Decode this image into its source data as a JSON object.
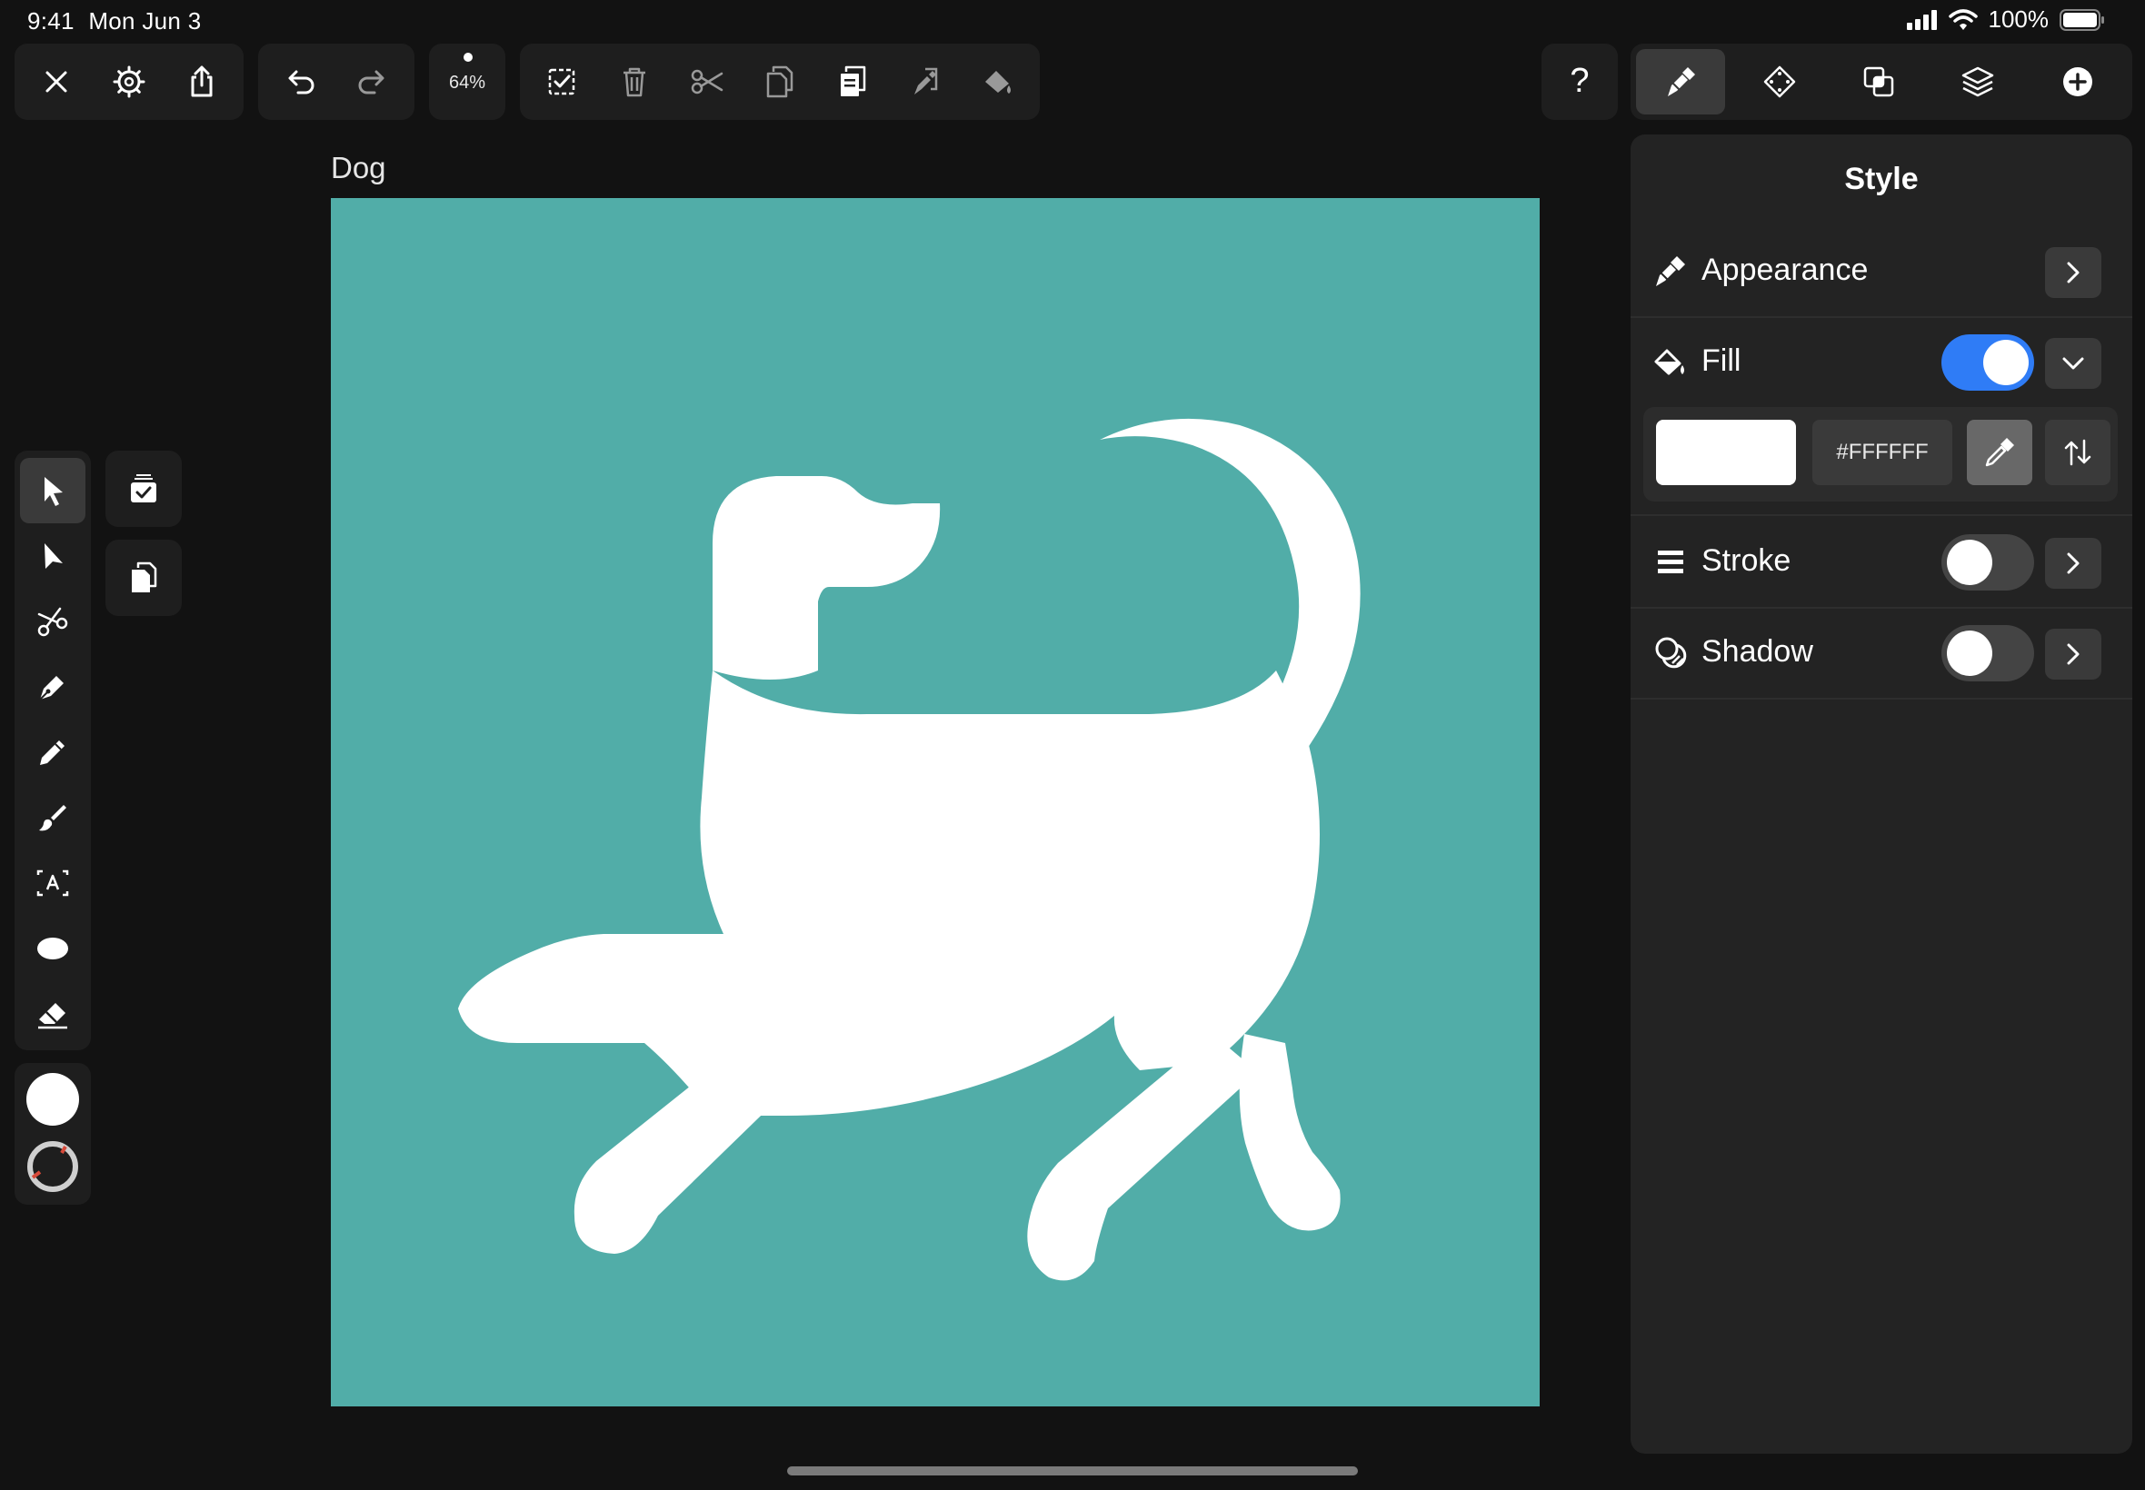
{
  "status_bar": {
    "time": "9:41",
    "date": "Mon Jun 3",
    "battery": "100%"
  },
  "toolbar": {
    "zoom": "64%",
    "left_group": [
      "close-icon",
      "settings-icon",
      "share-icon"
    ],
    "history_group": [
      "undo-icon",
      "redo-icon"
    ],
    "edit_group": [
      "select-all-icon",
      "trash-icon",
      "scissors-icon",
      "copy-icon",
      "paste-icon",
      "paste-style-icon",
      "fill-bucket-icon"
    ],
    "help_label": "?",
    "tabs": [
      "style-brush-icon",
      "shape-icon",
      "boolean-ops-icon",
      "layers-icon",
      "add-icon"
    ]
  },
  "document": {
    "title": "Dog",
    "canvas_color": "#51ada8",
    "artwork_color": "#ffffff"
  },
  "tools": [
    "selection-arrow-icon",
    "direct-selection-icon",
    "scissors-tool-icon",
    "pen-tool-icon",
    "pencil-tool-icon",
    "brush-tool-icon",
    "text-tool-icon",
    "ellipse-tool-icon",
    "eraser-tool-icon"
  ],
  "inspector": {
    "title": "Style",
    "appearance_label": "Appearance",
    "fill_label": "Fill",
    "fill_enabled": true,
    "fill_hex": "#FFFFFF",
    "stroke_label": "Stroke",
    "stroke_enabled": false,
    "shadow_label": "Shadow",
    "shadow_enabled": false
  },
  "colors": {
    "accent": "#2f7cf6",
    "panel": "#232323",
    "background": "#121212"
  }
}
